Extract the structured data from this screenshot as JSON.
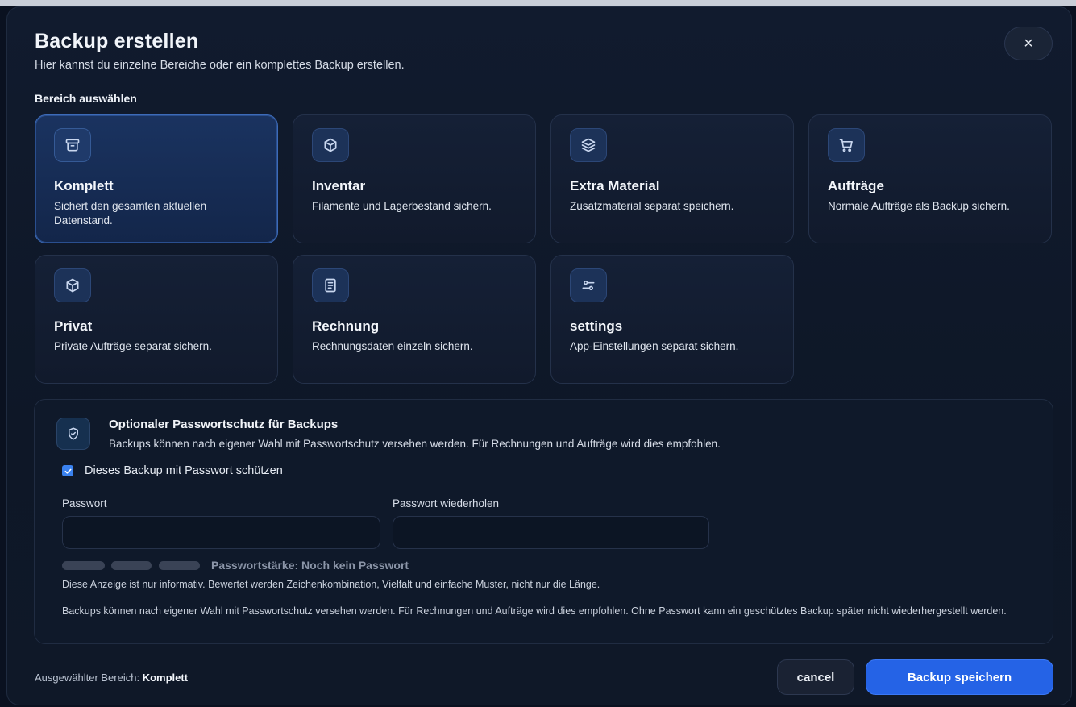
{
  "dialog": {
    "title": "Backup erstellen",
    "subtitle": "Hier kannst du einzelne Bereiche oder ein komplettes Backup erstellen.",
    "close_label": "×"
  },
  "scope": {
    "section_label": "Bereich auswählen",
    "cards": [
      {
        "title": "Komplett",
        "description": "Sichert den gesamten aktuellen Datenstand.",
        "icon": "archive-box-icon",
        "selected": true
      },
      {
        "title": "Inventar",
        "description": "Filamente und Lagerbestand sichern.",
        "icon": "cube-icon",
        "selected": false
      },
      {
        "title": "Extra Material",
        "description": "Zusatzmaterial separat speichern.",
        "icon": "layers-icon",
        "selected": false
      },
      {
        "title": "Aufträge",
        "description": "Normale Aufträge als Backup sichern.",
        "icon": "cart-icon",
        "selected": false
      },
      {
        "title": "Privat",
        "description": "Private Aufträge separat sichern.",
        "icon": "cube-icon",
        "selected": false
      },
      {
        "title": "Rechnung",
        "description": "Rechnungsdaten einzeln sichern.",
        "icon": "receipt-icon",
        "selected": false
      },
      {
        "title": "settings",
        "description": "App-Einstellungen separat sichern.",
        "icon": "sliders-icon",
        "selected": false
      }
    ]
  },
  "password": {
    "title": "Optionaler Passwortschutz für Backups",
    "description": "Backups können nach eigener Wahl mit Passwortschutz versehen werden. Für Rechnungen und Aufträge wird dies empfohlen.",
    "protect_label": "Dieses Backup mit Passwort schützen",
    "protect_checked": true,
    "password_label": "Passwort",
    "password_value": "",
    "repeat_label": "Passwort wiederholen",
    "repeat_value": "",
    "strength_text": "Passwortstärke: Noch kein Passwort",
    "strength_level": 0,
    "hint": "Diese Anzeige ist nur informativ. Bewertet werden Zeichenkombination, Vielfalt und einfache Muster, nicht nur die Länge.",
    "note": "Backups können nach eigener Wahl mit Passwortschutz versehen werden. Für Rechnungen und Aufträge wird dies empfohlen. Ohne Passwort kann ein geschütztes Backup später nicht wiederhergestellt werden."
  },
  "footer": {
    "selected_prefix": "Ausgewählter Bereich:",
    "selected_value": "Komplett",
    "cancel_label": "cancel",
    "save_label": "Backup speichern"
  },
  "colors": {
    "accent": "#2563e6",
    "background": "#0e1727",
    "selected_card": "#1a3360"
  }
}
